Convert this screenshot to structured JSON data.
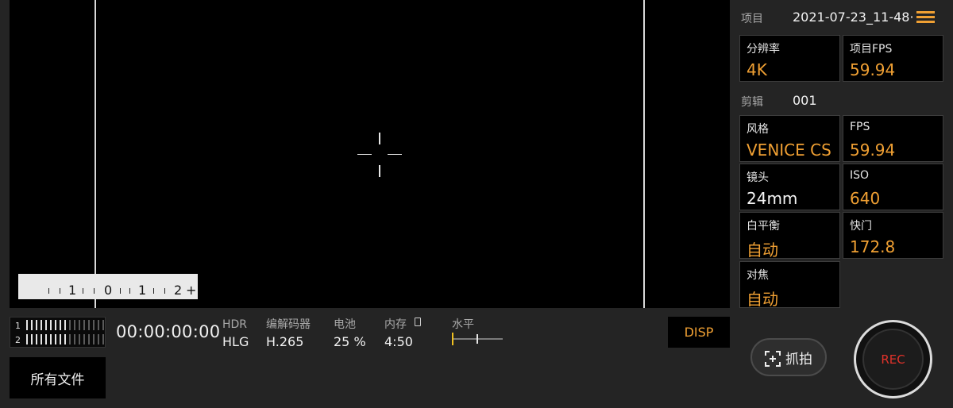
{
  "viewfinder": {
    "ev_scale": {
      "labels": [
        "1",
        "0",
        "1",
        "2",
        "+"
      ]
    }
  },
  "audio": {
    "channels": [
      {
        "label": "1",
        "level_fraction": 0.5
      },
      {
        "label": "2",
        "level_fraction": 0.5
      }
    ]
  },
  "status": {
    "timecode": "00:00:00:00",
    "hdr": {
      "label": "HDR",
      "value": "HLG"
    },
    "codec": {
      "label": "编解码器",
      "value": "H.265"
    },
    "battery": {
      "label": "电池",
      "value": "25 %"
    },
    "storage": {
      "label": "内存",
      "value": "4:50",
      "icon": "sd-card-icon"
    },
    "level": {
      "label": "水平"
    }
  },
  "buttons": {
    "disp": "DISP",
    "all_files": "所有文件",
    "snapshot": "抓拍",
    "rec": "REC"
  },
  "panel": {
    "project_label": "项目",
    "project_name": "2021-07-23_11-48·",
    "menu_icon": "hamburger-menu-icon",
    "clip_label": "剪辑",
    "clip_value": "001",
    "cells": {
      "resolution": {
        "label": "分辨率",
        "value": "4K"
      },
      "project_fps": {
        "label": "项目FPS",
        "value": "59.94"
      },
      "look": {
        "label": "风格",
        "value": "VENICE CS"
      },
      "fps": {
        "label": "FPS",
        "value": "59.94"
      },
      "lens": {
        "label": "镜头",
        "value": "24mm"
      },
      "iso": {
        "label": "ISO",
        "value": "640"
      },
      "wb": {
        "label": "白平衡",
        "value": "自动"
      },
      "shutter": {
        "label": "快门",
        "value": "172.8"
      },
      "focus": {
        "label": "对焦",
        "value": "自动"
      }
    }
  },
  "colors": {
    "accent": "#f0a033",
    "rec_red": "#e0322a",
    "background": "#242424"
  }
}
